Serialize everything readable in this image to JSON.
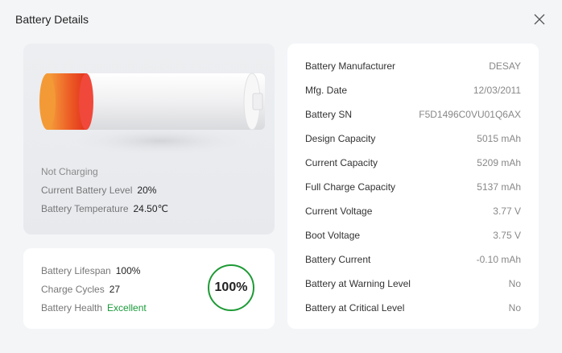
{
  "window": {
    "title": "Battery Details",
    "close_icon": "close-icon"
  },
  "battery": {
    "charging_status": "Not Charging",
    "level_label": "Current Battery Level",
    "level_value": "20%",
    "level_fraction": 0.2,
    "temperature_label": "Battery Temperature",
    "temperature_value": "24.50℃",
    "accent_color": "#e8431f"
  },
  "health": {
    "lifespan_label": "Battery Lifespan",
    "lifespan_value": "100%",
    "cycles_label": "Charge Cycles",
    "cycles_value": "27",
    "health_label": "Battery Health",
    "health_value": "Excellent",
    "health_color": "#1a9a3a",
    "ring_value": "100%",
    "ring_color": "#1e9a35"
  },
  "details": [
    {
      "label": "Battery Manufacturer",
      "value": "DESAY"
    },
    {
      "label": "Mfg. Date",
      "value": "12/03/2011"
    },
    {
      "label": "Battery SN",
      "value": "F5D1496C0VU01Q6AX"
    },
    {
      "label": "Design Capacity",
      "value": "5015 mAh"
    },
    {
      "label": "Current Capacity",
      "value": "5209 mAh"
    },
    {
      "label": "Full Charge Capacity",
      "value": "5137 mAh"
    },
    {
      "label": "Current Voltage",
      "value": "3.77 V"
    },
    {
      "label": "Boot Voltage",
      "value": "3.75 V"
    },
    {
      "label": "Battery Current",
      "value": "-0.10 mAh"
    },
    {
      "label": "Battery at Warning Level",
      "value": "No"
    },
    {
      "label": "Battery at Critical Level",
      "value": "No"
    }
  ]
}
